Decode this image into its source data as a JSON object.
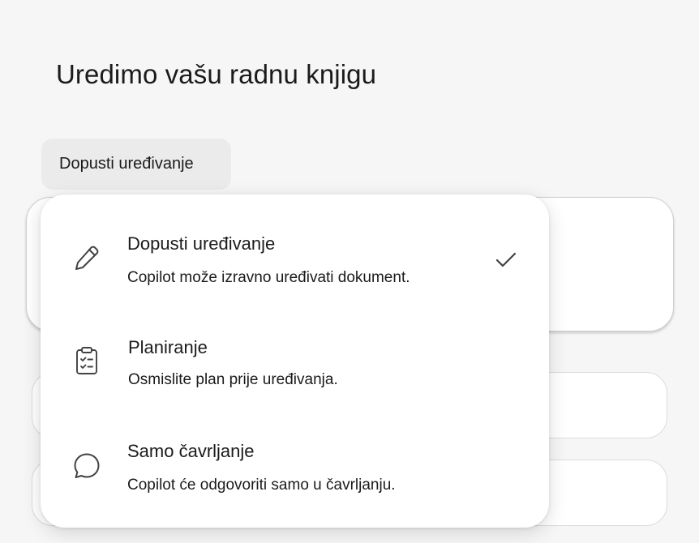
{
  "page": {
    "title": "Uredimo vašu radnu knjigu"
  },
  "mode_chip": {
    "label": "Dopusti uređivanje"
  },
  "menu": {
    "options": [
      {
        "title": "Dopusti uređivanje",
        "description": "Copilot može izravno uređivati dokument.",
        "icon": "pencil-icon",
        "selected": true
      },
      {
        "title": "Planiranje",
        "description": "Osmislite plan prije uređivanja.",
        "icon": "clipboard-checklist-icon",
        "selected": false
      },
      {
        "title": "Samo čavrljanje",
        "description": "Copilot će odgovoriti samo u čavrljanju.",
        "icon": "chat-bubble-icon",
        "selected": false
      }
    ],
    "selected_icon": "checkmark-icon"
  },
  "colors": {
    "background": "#f6f6f6",
    "chip": "#ebebeb",
    "menu": "#ffffff",
    "text": "#1b1b1b",
    "icon": "#424242"
  }
}
